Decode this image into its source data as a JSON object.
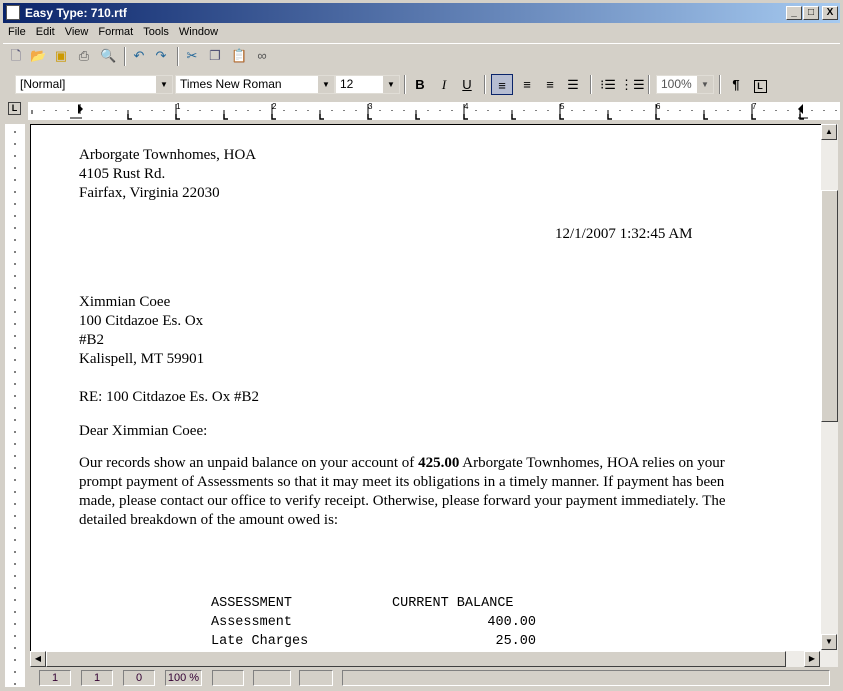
{
  "window": {
    "title": "Easy Type: 710.rtf",
    "minimize": "_",
    "maximize": "□",
    "close": "X"
  },
  "menu": [
    "File",
    "Edit",
    "View",
    "Format",
    "Tools",
    "Window"
  ],
  "toolbar": {
    "icons": [
      "new-icon",
      "open-icon",
      "save-icon",
      "print-icon",
      "print-preview-icon",
      "undo-icon",
      "redo-icon",
      "cut-icon",
      "copy-icon",
      "paste-icon",
      "find-icon"
    ]
  },
  "format": {
    "style": "[Normal]",
    "font": "Times New Roman",
    "size": "12",
    "bold": "B",
    "italic": "I",
    "underline": "U",
    "zoom": "100%",
    "pilcrow": "¶",
    "alignment": "left"
  },
  "ruler": {
    "numbers": [
      "1",
      "2",
      "3",
      "4",
      "5",
      "6",
      "7"
    ],
    "tab_button": "L"
  },
  "document": {
    "sender": [
      "Arborgate Townhomes, HOA",
      "4105 Rust Rd.",
      "Fairfax, Virginia 22030"
    ],
    "date": "12/1/2007 1:32:45 AM",
    "recipient": [
      "Ximmian Coee",
      "100 Citdazoe Es. Ox",
      "#B2",
      "Kalispell, MT 59901"
    ],
    "re": "RE:  100 Citdazoe Es. Ox #B2",
    "salutation": "Dear Ximmian Coee:",
    "body_pre": "Our records show an unpaid balance on your account of ",
    "body_amount": "425.00",
    "body_post": " Arborgate Townhomes, HOA relies on your",
    "body_lines": [
      "prompt payment of Assessments so that it may meet its obligations in a timely manner.  If payment has been",
      "made, please contact our office to verify receipt.  Otherwise, please forward your payment immediately.  The",
      "detailed breakdown of the amount owed is:"
    ],
    "table": {
      "headers": [
        "ASSESSMENT",
        "CURRENT BALANCE"
      ],
      "rows": [
        [
          "Assessment",
          "400.00"
        ],
        [
          "Late Charges",
          "25.00"
        ]
      ]
    }
  },
  "status": [
    "1",
    "1",
    "0",
    "100 %",
    "",
    "",
    "",
    ""
  ]
}
